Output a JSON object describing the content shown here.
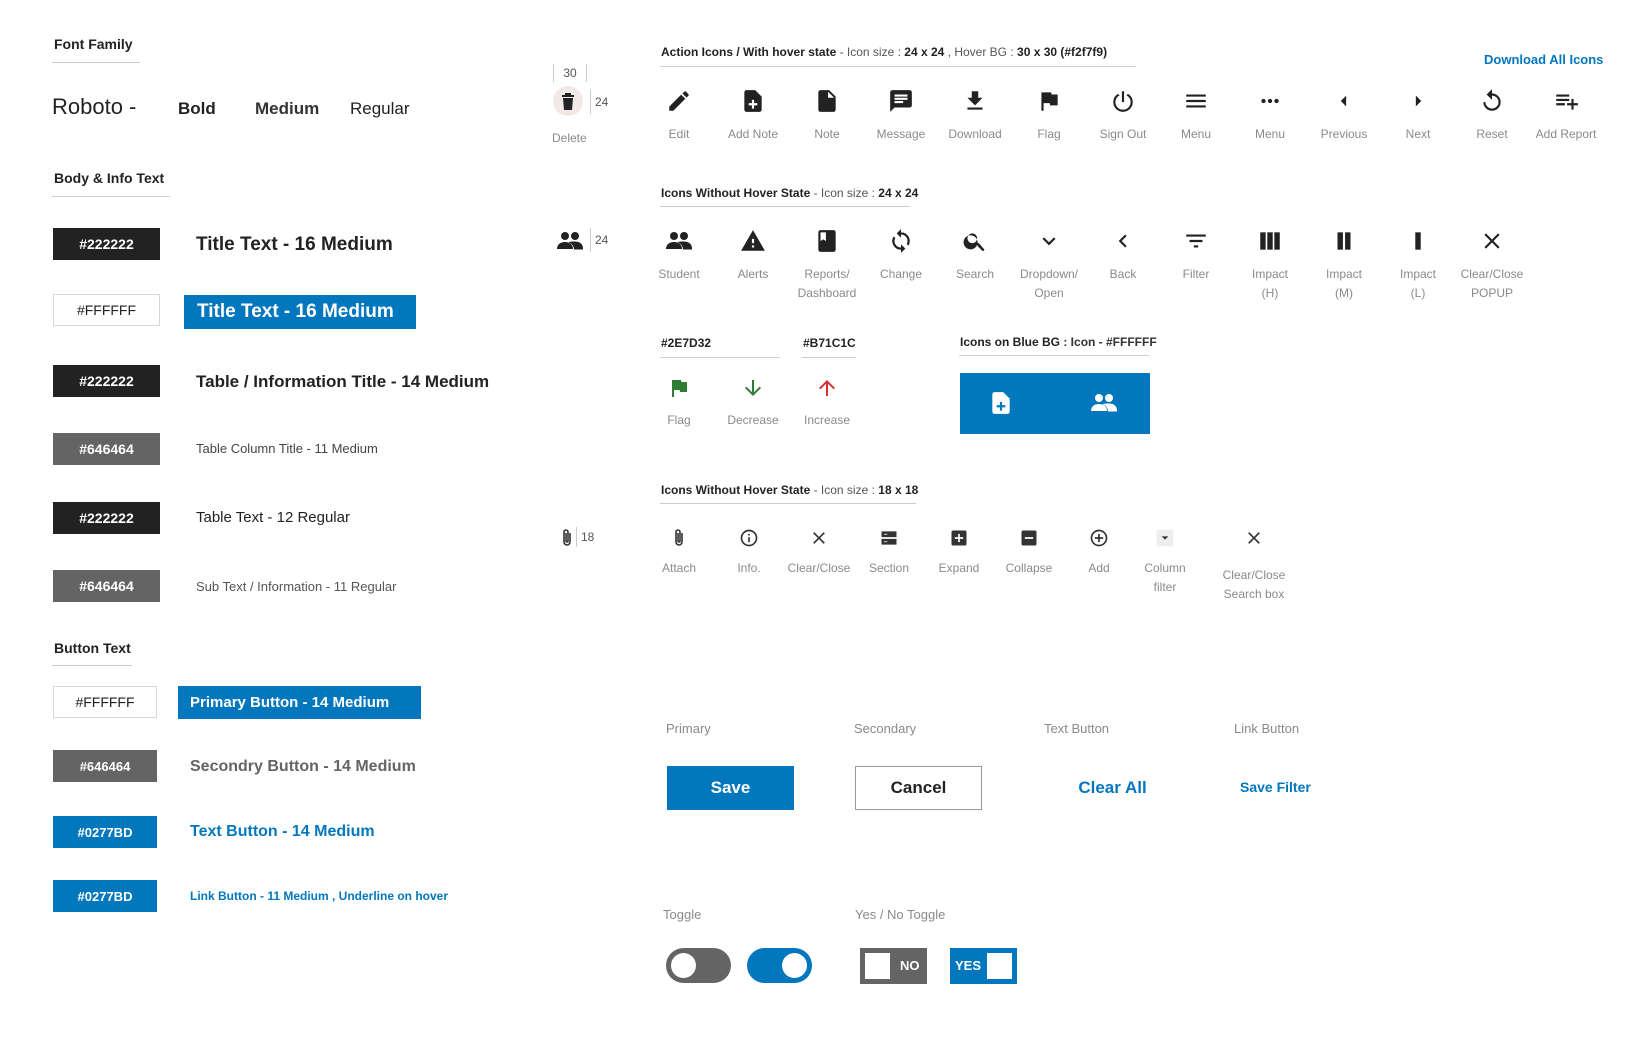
{
  "left": {
    "font_family_header": "Font Family",
    "font_name": "Roboto -",
    "weights": [
      "Bold",
      "Medium",
      "Regular"
    ],
    "body_header": "Body & Info Text",
    "body_rows": [
      {
        "swatch": "#222222",
        "sample": "Title Text - 16 Medium"
      },
      {
        "swatch": "#FFFFFF",
        "sample": "Title Text - 16 Medium"
      },
      {
        "swatch": "#222222",
        "sample": "Table / Information Title - 14 Medium"
      },
      {
        "swatch": "#646464",
        "sample": "Table Column Title - 11 Medium"
      },
      {
        "swatch": "#222222",
        "sample": "Table Text  - 12 Regular"
      },
      {
        "swatch": "#646464",
        "sample": "Sub Text / Information - 11 Regular"
      }
    ],
    "button_header": "Button Text",
    "button_rows": [
      {
        "swatch": "#FFFFFF",
        "sample": "Primary Button  - 14 Medium"
      },
      {
        "swatch": "#646464",
        "sample": "Secondry Button - 14 Medium"
      },
      {
        "swatch": "#0277BD",
        "sample": "Text Button  - 14 Medium"
      },
      {
        "swatch": "#0277BD",
        "sample": "Link Button - 11 Medium , Underline on hover"
      }
    ]
  },
  "dims": {
    "delete_w": "30",
    "delete_h": "24",
    "delete_label": "Delete",
    "student_size": "24",
    "attach_size": "18"
  },
  "action": {
    "title_bold": "Action Icons / With hover state",
    "title_rest_1": " - Icon size : ",
    "title_size": "24 x 24",
    "title_rest_2": " , Hover BG : ",
    "title_hover": "30 x 30 (#f2f7f9)",
    "download_all": "Download All Icons",
    "icons": [
      {
        "icon": "edit-icon",
        "label": "Edit"
      },
      {
        "icon": "add-note-icon",
        "label": "Add Note"
      },
      {
        "icon": "note-icon",
        "label": "Note"
      },
      {
        "icon": "message-icon",
        "label": "Message"
      },
      {
        "icon": "download-icon",
        "label": "Download"
      },
      {
        "icon": "flag-icon",
        "label": "Flag"
      },
      {
        "icon": "sign-out-icon",
        "label": "Sign Out"
      },
      {
        "icon": "menu-icon",
        "label": "Menu"
      },
      {
        "icon": "more-icon",
        "label": "Menu"
      },
      {
        "icon": "previous-icon",
        "label": "Previous"
      },
      {
        "icon": "next-icon",
        "label": "Next"
      },
      {
        "icon": "reset-icon",
        "label": "Reset"
      },
      {
        "icon": "add-report-icon",
        "label": "Add Report"
      }
    ]
  },
  "nohover24": {
    "title_bold": "Icons Without Hover State",
    "title_rest": " - Icon size : ",
    "title_size": "24 x 24",
    "icons": [
      {
        "icon": "student-icon",
        "label": "Student"
      },
      {
        "icon": "alert-icon",
        "label": "Alerts"
      },
      {
        "icon": "reports-icon",
        "label": "Reports/\nDashboard"
      },
      {
        "icon": "change-icon",
        "label": "Change"
      },
      {
        "icon": "search-icon",
        "label": "Search"
      },
      {
        "icon": "dropdown-icon",
        "label": "Dropdown/\nOpen"
      },
      {
        "icon": "back-icon",
        "label": "Back"
      },
      {
        "icon": "filter-icon",
        "label": "Filter"
      },
      {
        "icon": "impact-h-icon",
        "label": "Impact\n(H)"
      },
      {
        "icon": "impact-m-icon",
        "label": "Impact\n(M)"
      },
      {
        "icon": "impact-l-icon",
        "label": "Impact\n(L)"
      },
      {
        "icon": "close-icon",
        "label": "Clear/Close\nPOPUP"
      }
    ]
  },
  "colors": {
    "green": "#2E7D32",
    "red": "#B71C1C",
    "blue": "#0277BD",
    "icons": [
      {
        "icon": "flag-green-icon",
        "label": "Flag"
      },
      {
        "icon": "decrease-icon",
        "label": "Decrease"
      },
      {
        "icon": "increase-icon",
        "label": "Increase"
      }
    ]
  },
  "bluebg": {
    "title_bold": "Icons on Blue BG",
    "title_rest": " : Icon - #FFFFFF"
  },
  "nohover18": {
    "title_bold": "Icons Without Hover State",
    "title_rest": " - Icon size : ",
    "title_size": "18 x 18",
    "icons": [
      {
        "icon": "attach-icon",
        "label": "Attach"
      },
      {
        "icon": "info-icon",
        "label": "Info."
      },
      {
        "icon": "clear-close-icon",
        "label": "Clear/Close"
      },
      {
        "icon": "section-icon",
        "label": "Section"
      },
      {
        "icon": "expand-icon",
        "label": "Expand"
      },
      {
        "icon": "collapse-icon",
        "label": "Collapse"
      },
      {
        "icon": "add-circle-icon",
        "label": "Add"
      },
      {
        "icon": "column-filter-icon",
        "label": "Column\nfilter"
      },
      {
        "icon": "clear-search-icon",
        "label": "Clear/Close\nSearch box"
      }
    ]
  },
  "buttons": {
    "primary_caption": "Primary",
    "secondary_caption": "Secondary",
    "text_caption": "Text Button",
    "link_caption": "Link Button",
    "save": "Save",
    "cancel": "Cancel",
    "clear_all": "Clear All",
    "save_filter": "Save Filter"
  },
  "toggles": {
    "toggle_caption": "Toggle",
    "yesno_caption": "Yes / No Toggle",
    "no": "NO",
    "yes": "YES"
  }
}
